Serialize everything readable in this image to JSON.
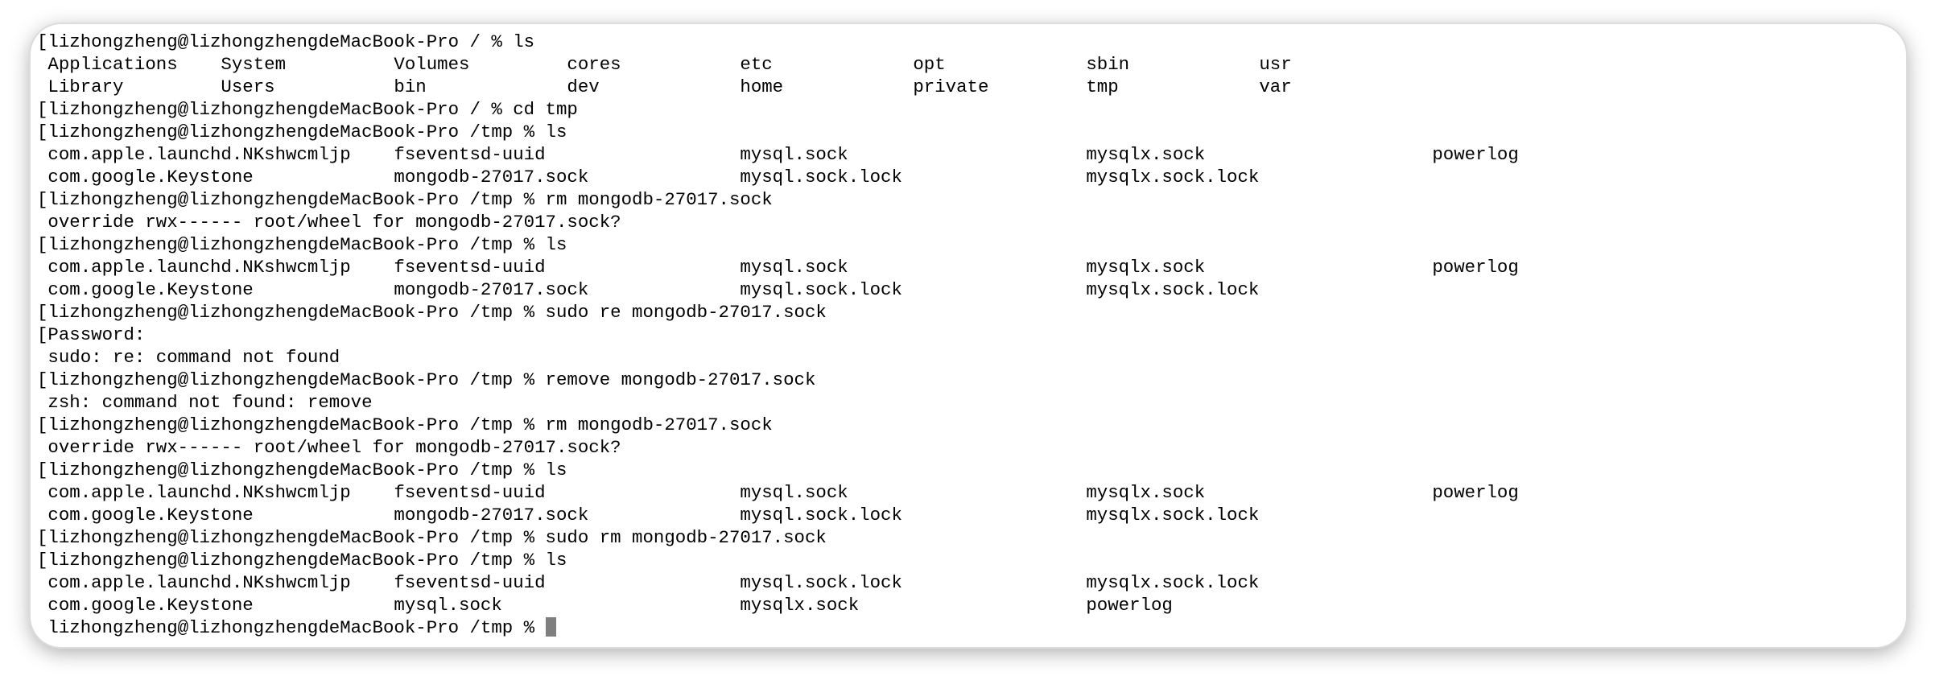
{
  "terminal": {
    "lines": [
      "[lizhongzheng@lizhongzhengdeMacBook-Pro / % ls",
      " Applications    System          Volumes         cores           etc             opt             sbin            usr",
      " Library         Users           bin             dev             home            private         tmp             var",
      "[lizhongzheng@lizhongzhengdeMacBook-Pro / % cd tmp",
      "[lizhongzheng@lizhongzhengdeMacBook-Pro /tmp % ls",
      " com.apple.launchd.NKshwcmljp    fseventsd-uuid                  mysql.sock                      mysqlx.sock                     powerlog",
      " com.google.Keystone             mongodb-27017.sock              mysql.sock.lock                 mysqlx.sock.lock",
      "[lizhongzheng@lizhongzhengdeMacBook-Pro /tmp % rm mongodb-27017.sock",
      " override rwx------ root/wheel for mongodb-27017.sock?",
      "[lizhongzheng@lizhongzhengdeMacBook-Pro /tmp % ls",
      " com.apple.launchd.NKshwcmljp    fseventsd-uuid                  mysql.sock                      mysqlx.sock                     powerlog",
      " com.google.Keystone             mongodb-27017.sock              mysql.sock.lock                 mysqlx.sock.lock",
      "[lizhongzheng@lizhongzhengdeMacBook-Pro /tmp % sudo re mongodb-27017.sock",
      "[Password:",
      " sudo: re: command not found",
      "[lizhongzheng@lizhongzhengdeMacBook-Pro /tmp % remove mongodb-27017.sock",
      " zsh: command not found: remove",
      "[lizhongzheng@lizhongzhengdeMacBook-Pro /tmp % rm mongodb-27017.sock",
      " override rwx------ root/wheel for mongodb-27017.sock?",
      "[lizhongzheng@lizhongzhengdeMacBook-Pro /tmp % ls",
      " com.apple.launchd.NKshwcmljp    fseventsd-uuid                  mysql.sock                      mysqlx.sock                     powerlog",
      " com.google.Keystone             mongodb-27017.sock              mysql.sock.lock                 mysqlx.sock.lock",
      "[lizhongzheng@lizhongzhengdeMacBook-Pro /tmp % sudo rm mongodb-27017.sock",
      "[lizhongzheng@lizhongzhengdeMacBook-Pro /tmp % ls",
      " com.apple.launchd.NKshwcmljp    fseventsd-uuid                  mysql.sock.lock                 mysqlx.sock.lock",
      " com.google.Keystone             mysql.sock                      mysqlx.sock                     powerlog"
    ],
    "current_prompt": " lizhongzheng@lizhongzhengdeMacBook-Pro /tmp % "
  },
  "colors": {
    "background": "#ffffff",
    "text": "#000000",
    "cursor": "#7f7f7f"
  }
}
